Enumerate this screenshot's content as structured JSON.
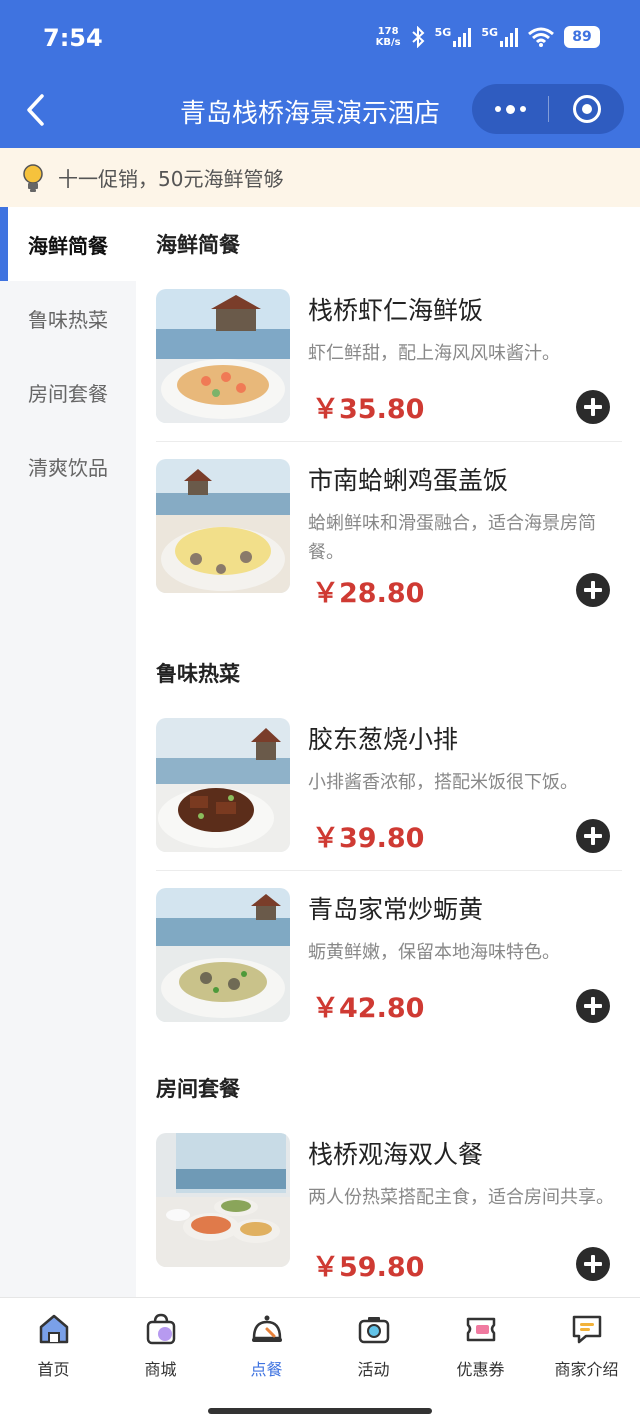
{
  "status_bar": {
    "time": "7:54",
    "net_speed_value": "178",
    "net_speed_unit": "KB/s",
    "sim1": "5G",
    "sim2": "5G",
    "battery": "89"
  },
  "nav": {
    "title": "青岛栈桥海景演示酒店"
  },
  "notice": {
    "text": "十一促销，50元海鲜管够"
  },
  "sidebar": {
    "items": [
      {
        "label": "海鲜简餐",
        "active": true
      },
      {
        "label": "鲁味热菜"
      },
      {
        "label": "房间套餐"
      },
      {
        "label": "清爽饮品"
      }
    ]
  },
  "sections": [
    {
      "title": "海鲜简餐",
      "dishes": [
        {
          "name": "栈桥虾仁海鲜饭",
          "desc": "虾仁鲜甜，配上海风风味酱汁。",
          "price": "￥35.80"
        },
        {
          "name": "市南蛤蜊鸡蛋盖饭",
          "desc": "蛤蜊鲜味和滑蛋融合，适合海景房简餐。",
          "price": "￥28.80"
        }
      ]
    },
    {
      "title": "鲁味热菜",
      "dishes": [
        {
          "name": "胶东葱烧小排",
          "desc": "小排酱香浓郁，搭配米饭很下饭。",
          "price": "￥39.80"
        },
        {
          "name": "青岛家常炒蛎黄",
          "desc": "蛎黄鲜嫩，保留本地海味特色。",
          "price": "￥42.80"
        }
      ]
    },
    {
      "title": "房间套餐",
      "dishes": [
        {
          "name": "栈桥观海双人餐",
          "desc": "两人份热菜搭配主食，适合房间共享。",
          "price": "￥59.80"
        }
      ]
    }
  ],
  "tabbar": {
    "items": [
      {
        "label": "首页",
        "icon": "home-icon"
      },
      {
        "label": "商城",
        "icon": "shopping-bag-icon"
      },
      {
        "label": "点餐",
        "icon": "food-cloche-icon",
        "active": true
      },
      {
        "label": "活动",
        "icon": "camera-icon"
      },
      {
        "label": "优惠券",
        "icon": "coupon-icon"
      },
      {
        "label": "商家介绍",
        "icon": "message-icon"
      }
    ]
  },
  "colors": {
    "brand": "#3f73e0",
    "price": "#cf3a33",
    "notice_bg": "#fdf5e8"
  }
}
